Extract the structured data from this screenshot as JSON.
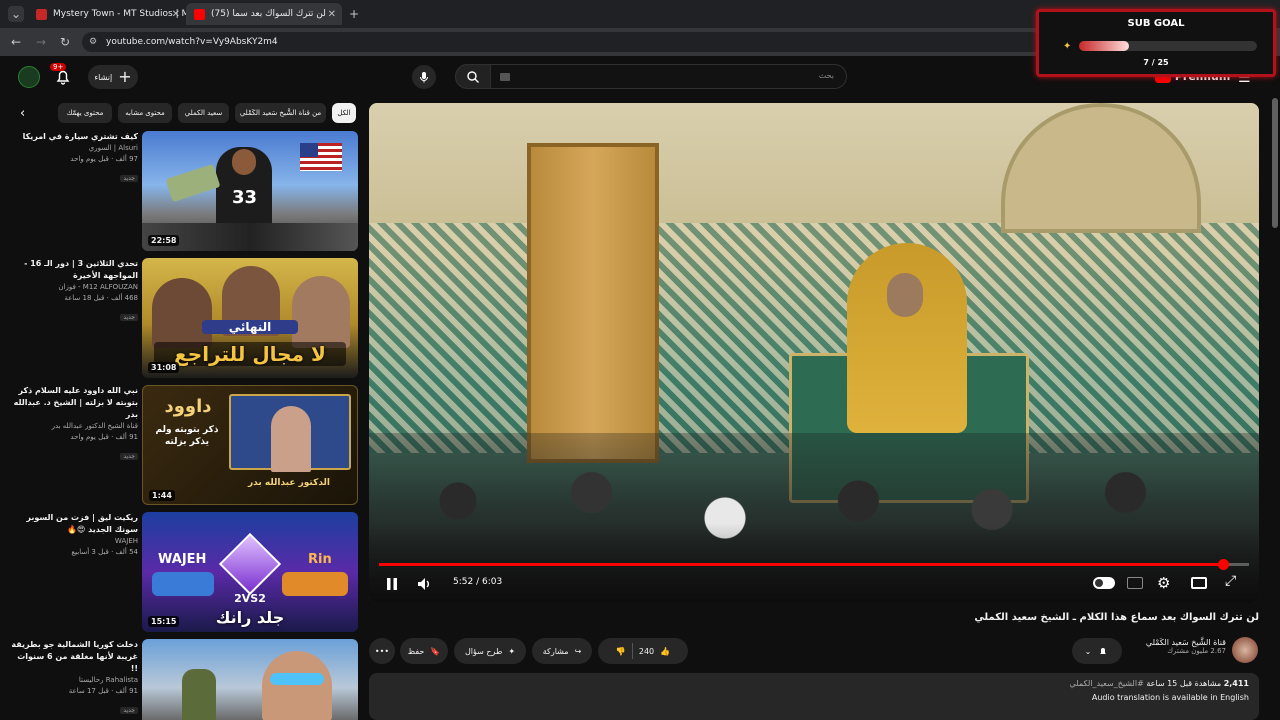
{
  "browser": {
    "tabs": [
      {
        "title": "Mystery Town - MT Studios | M",
        "active": false
      },
      {
        "title": "(75) لن تترك السواك بعد سما",
        "active": true
      }
    ],
    "url": "youtube.com/watch?v=Vy9AbsKY2m4"
  },
  "youtube": {
    "search_placeholder": "بحث",
    "create_label": "إنشاء",
    "notification_count": "9+",
    "premium_label": "Premium"
  },
  "chips": [
    {
      "label": "الكل"
    },
    {
      "label": "من قناة الشَّيخ سَعيد الكَمْلي"
    },
    {
      "label": "سعيد الكملي"
    },
    {
      "label": "محتوى مشابه"
    },
    {
      "label": "محتوى يهمّك"
    }
  ],
  "related": [
    {
      "title": "كيف تشتري سيارة في امريكا",
      "channel": "Alsuri | السوري",
      "meta": "97 ألف · قبل يوم واحد",
      "badge": "جديد",
      "duration": "22:58"
    },
    {
      "title": "تحدي الثلاثين 3 | دور الـ 16 - المواجهة الأخيرة",
      "channel": "M12 ALFOUZAN - فوزان",
      "meta": "468 ألف · قبل 18 ساعة",
      "badge": "جديد",
      "duration": "31:08"
    },
    {
      "title": "نبي الله داوود عليه السلام ذكر بتوبته لا بزلته | الشيخ د. عبدالله بدر",
      "channel": "قناة الشيخ الدكتور عبدالله بدر",
      "meta": "91 ألف · قبل يوم واحد",
      "badge": "جديد",
      "duration": "1:44"
    },
    {
      "title": "ريكيت ليق | فزت من السوبر سونك الجديد 😍🔥",
      "channel": "WAJEH",
      "meta": "54 ألف · قبل 3 أسابيع",
      "badge": "",
      "duration": "15:15"
    },
    {
      "title": "دخلت كوريا الشمالية جو بطريقة غريبة لأنها مغلقة من 6 سنوات !!",
      "channel": "Rahalista رحاليستا",
      "meta": "91 ألف · قبل 17 ساعة",
      "badge": "جديد",
      "duration": ""
    }
  ],
  "thumb_text": {
    "r2_caption": "لا مجال للتراجع",
    "r2_sub": "النهائي",
    "r3_title": "داوود",
    "r3_sub": "ذكر بتوبته ولم يذكر بزلته",
    "r3_name": "الدكتور عبدالله بدر",
    "r4_left": "WAJEH",
    "r4_right": "Rin",
    "r4_vs": "2VS2",
    "r4_caption": "جلد رانك"
  },
  "player": {
    "time": "5:52 / 6:03",
    "progress": 0.97
  },
  "video": {
    "title": "لن تترك السواك بعد سماع هذا الكلام ـ الشيخ سعيد الكملي",
    "channel": "قناة الشَّيخ سَعيد الكَمْلي",
    "subscribers": "2.67 مليون مشترك",
    "likes": "240",
    "share_label": "مشاركة",
    "ask_label": "طرح سؤال",
    "save_label": "حفظ",
    "views": "2,411",
    "views_suffix": "مشاهدة  قبل 15 ساعة",
    "hashtag": "#الشيخ_سعيد_الكملي",
    "audio_translation": "Audio translation is available in English"
  },
  "subgoal": {
    "title": "SUB GOAL",
    "count": "7 / 25",
    "progress": 0.28
  },
  "colors": {
    "accent": "#ff0000",
    "goal_border": "#b3121b"
  }
}
